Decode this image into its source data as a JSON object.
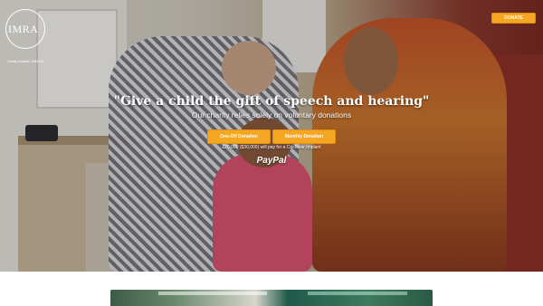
{
  "logo": {
    "name": "IMRA",
    "subtitle": "Charity Number: 1085144"
  },
  "header": {
    "donate_label": "DONATE"
  },
  "hero": {
    "headline": "\"Give a child the gift of speech and hearing\"",
    "subheadline": "Our charity relies solely on voluntary donations",
    "buttons": {
      "one_off": "One-Off Donation",
      "monthly": "Monthly Donation"
    },
    "note": "£20,000 ($30,000) will pay for a Cochlear Implant",
    "payment_logo": "PayPal"
  },
  "colors": {
    "accent": "#f5a623",
    "text_on_hero": "#ffffff"
  },
  "icons": {
    "logo": "imra-logo-icon"
  }
}
